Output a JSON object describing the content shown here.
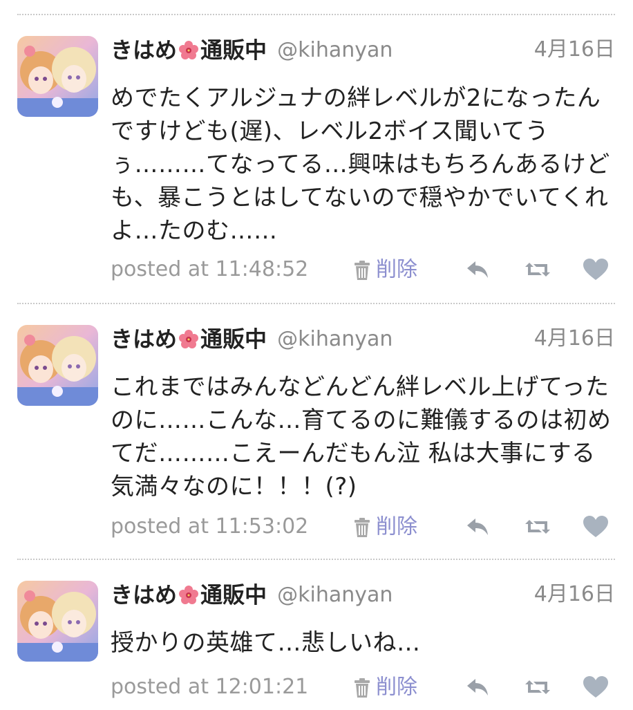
{
  "tweets": [
    {
      "name": "きはめ",
      "name_suffix": "通販中",
      "handle": "@kihanyan",
      "date": "4月16日",
      "text": "めでたくアルジュナの絆レベルが2になったんですけども(遅)、レベル2ボイス聞いてうぅ………てなってる…興味はもちろんあるけども、暴こうとはしてないので穏やかでいてくれよ…たのむ……",
      "posted": "posted at 11:48:52",
      "delete_label": "削除"
    },
    {
      "name": "きはめ",
      "name_suffix": "通販中",
      "handle": "@kihanyan",
      "date": "4月16日",
      "text": "これまではみんなどんどん絆レベル上げてったのに……こんな…育てるのに難儀するのは初めてだ………こえーんだもん泣 私は大事にする気満々なのに！！！(?)",
      "posted": "posted at 11:53:02",
      "delete_label": "削除"
    },
    {
      "name": "きはめ",
      "name_suffix": "通販中",
      "handle": "@kihanyan",
      "date": "4月16日",
      "text": "授かりの英雄て…悲しいね…",
      "posted": "posted at 12:01:21",
      "delete_label": "削除"
    }
  ],
  "icons": {
    "name_emoji": "hibiscus-icon",
    "delete": "trash-icon",
    "reply": "reply-icon",
    "retweet": "retweet-icon",
    "favorite": "heart-icon"
  },
  "colors": {
    "delete_link": "#8c8fcf",
    "muted_text": "#8a8a8a",
    "action_icon": "#9aa0a8",
    "heart": "#a9b3bf",
    "divider": "#c8c8c8"
  }
}
